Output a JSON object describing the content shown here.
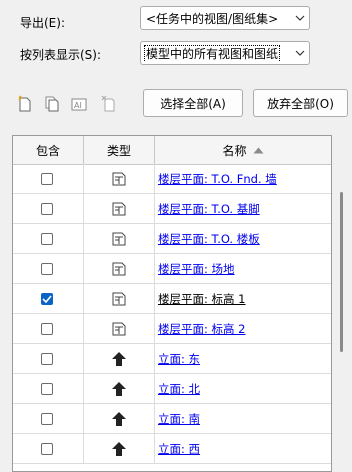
{
  "export_label": "导出(E):",
  "export_value": "<任务中的视图/图纸集>",
  "list_label": "按列表显示(S):",
  "list_value": "模型中的所有视图和图纸",
  "toolbar": {
    "icons": [
      "new-set-icon",
      "duplicate-icon",
      "rename-icon",
      "delete-icon"
    ]
  },
  "buttons": {
    "select_all": "选择全部(A)",
    "deselect_all": "放弃全部(O)"
  },
  "table": {
    "headers": {
      "include": "包含",
      "type": "类型",
      "name": "名称"
    },
    "rows": [
      {
        "checked": false,
        "type": "plan",
        "name": "楼层平面: T.O. Fnd. 墙",
        "link": true
      },
      {
        "checked": false,
        "type": "plan",
        "name": "楼层平面: T.O. 基脚",
        "link": true
      },
      {
        "checked": false,
        "type": "plan",
        "name": "楼层平面: T.O. 楼板",
        "link": true
      },
      {
        "checked": false,
        "type": "plan",
        "name": "楼层平面: 场地",
        "link": true
      },
      {
        "checked": true,
        "type": "plan",
        "name": "楼层平面: 标高 1",
        "link": false
      },
      {
        "checked": false,
        "type": "plan",
        "name": "楼层平面: 标高 2",
        "link": true
      },
      {
        "checked": false,
        "type": "elevation",
        "name": "立面: 东",
        "link": true
      },
      {
        "checked": false,
        "type": "elevation",
        "name": "立面: 北",
        "link": true
      },
      {
        "checked": false,
        "type": "elevation",
        "name": "立面: 南",
        "link": true
      },
      {
        "checked": false,
        "type": "elevation",
        "name": "立面: 西",
        "link": true
      }
    ]
  }
}
